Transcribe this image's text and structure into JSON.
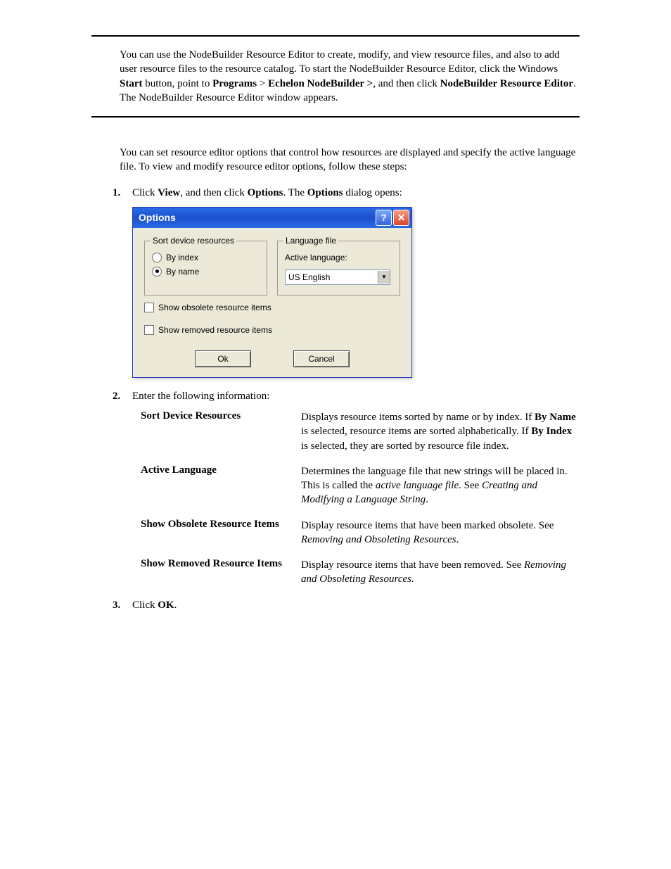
{
  "intro": {
    "p1_pre": "You can use the NodeBuilder Resource Editor to create, modify, and view resource files, and also to add user resource files to the resource catalog.  To start the NodeBuilder Resource Editor, click the Windows ",
    "p1_b1": "Start",
    "p1_mid1": " button, point to ",
    "p1_b2": "Programs",
    "p1_mid2": " > ",
    "p1_b3": "Echelon NodeBuilder >",
    "p1_mid3": ", and then click ",
    "p1_b4": "NodeBuilder Resource Editor",
    "p1_post": ".  The NodeBuilder Resource Editor window appears.",
    "p2": "You can set resource editor options that control how resources are displayed and specify the active language file.  To view and modify resource editor options, follow these steps:"
  },
  "steps": {
    "n1": "1.",
    "s1_pre": "Click ",
    "s1_b1": "View",
    "s1_mid1": ", and then click ",
    "s1_b2": "Options",
    "s1_mid2": ".  The ",
    "s1_b3": "Options",
    "s1_post": " dialog opens:",
    "n2": "2.",
    "s2": "Enter the following information:",
    "n3": "3.",
    "s3_pre": "Click ",
    "s3_b1": "OK",
    "s3_post": "."
  },
  "dialog": {
    "title": "Options",
    "sort_legend": "Sort device resources",
    "radio_index": "By index",
    "radio_name": "By name",
    "lang_legend": "Language file",
    "active_language_label": "Active language:",
    "language_value": "US English",
    "chk_obsolete": "Show obsolete resource items",
    "chk_removed": "Show removed resource items",
    "ok": "Ok",
    "cancel": "Cancel"
  },
  "defs": {
    "t1": "Sort Device Resources",
    "d1_pre": "Displays resource items sorted by name or by index.  If ",
    "d1_b1": "By Name",
    "d1_mid1": " is selected, resource items are sorted alphabetically.  If ",
    "d1_b2": "By Index",
    "d1_post": " is selected, they are sorted by resource file index.",
    "t2": "Active Language",
    "d2_pre": "Determines the language file that new strings will be placed in.  This is called the ",
    "d2_i1": "active language file",
    "d2_mid1": ".  See ",
    "d2_i2": "Creating and Modifying a Language String",
    "d2_post": ".",
    "t3": "Show Obsolete Resource Items",
    "d3_pre": "Display resource items that have been marked obsolete.  See ",
    "d3_i1": "Removing and Obsoleting Resources",
    "d3_post": ".",
    "t4": "Show Removed Resource Items",
    "d4_pre": "Display resource items that have been removed.  See ",
    "d4_i1": "Removing and Obsoleting Resources",
    "d4_post": "."
  }
}
